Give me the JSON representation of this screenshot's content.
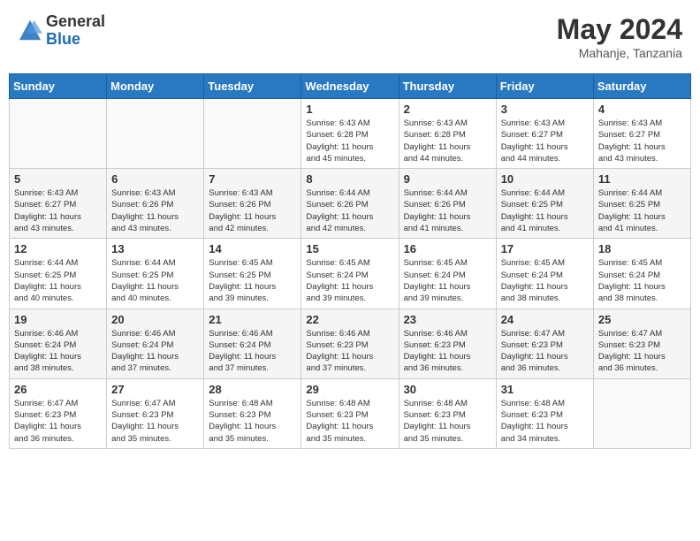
{
  "header": {
    "logo_general": "General",
    "logo_blue": "Blue",
    "month_title": "May 2024",
    "subtitle": "Mahanje, Tanzania"
  },
  "weekdays": [
    "Sunday",
    "Monday",
    "Tuesday",
    "Wednesday",
    "Thursday",
    "Friday",
    "Saturday"
  ],
  "weeks": [
    [
      {
        "day": "",
        "info": ""
      },
      {
        "day": "",
        "info": ""
      },
      {
        "day": "",
        "info": ""
      },
      {
        "day": "1",
        "info": "Sunrise: 6:43 AM\nSunset: 6:28 PM\nDaylight: 11 hours\nand 45 minutes."
      },
      {
        "day": "2",
        "info": "Sunrise: 6:43 AM\nSunset: 6:28 PM\nDaylight: 11 hours\nand 44 minutes."
      },
      {
        "day": "3",
        "info": "Sunrise: 6:43 AM\nSunset: 6:27 PM\nDaylight: 11 hours\nand 44 minutes."
      },
      {
        "day": "4",
        "info": "Sunrise: 6:43 AM\nSunset: 6:27 PM\nDaylight: 11 hours\nand 43 minutes."
      }
    ],
    [
      {
        "day": "5",
        "info": "Sunrise: 6:43 AM\nSunset: 6:27 PM\nDaylight: 11 hours\nand 43 minutes."
      },
      {
        "day": "6",
        "info": "Sunrise: 6:43 AM\nSunset: 6:26 PM\nDaylight: 11 hours\nand 43 minutes."
      },
      {
        "day": "7",
        "info": "Sunrise: 6:43 AM\nSunset: 6:26 PM\nDaylight: 11 hours\nand 42 minutes."
      },
      {
        "day": "8",
        "info": "Sunrise: 6:44 AM\nSunset: 6:26 PM\nDaylight: 11 hours\nand 42 minutes."
      },
      {
        "day": "9",
        "info": "Sunrise: 6:44 AM\nSunset: 6:26 PM\nDaylight: 11 hours\nand 41 minutes."
      },
      {
        "day": "10",
        "info": "Sunrise: 6:44 AM\nSunset: 6:25 PM\nDaylight: 11 hours\nand 41 minutes."
      },
      {
        "day": "11",
        "info": "Sunrise: 6:44 AM\nSunset: 6:25 PM\nDaylight: 11 hours\nand 41 minutes."
      }
    ],
    [
      {
        "day": "12",
        "info": "Sunrise: 6:44 AM\nSunset: 6:25 PM\nDaylight: 11 hours\nand 40 minutes."
      },
      {
        "day": "13",
        "info": "Sunrise: 6:44 AM\nSunset: 6:25 PM\nDaylight: 11 hours\nand 40 minutes."
      },
      {
        "day": "14",
        "info": "Sunrise: 6:45 AM\nSunset: 6:25 PM\nDaylight: 11 hours\nand 39 minutes."
      },
      {
        "day": "15",
        "info": "Sunrise: 6:45 AM\nSunset: 6:24 PM\nDaylight: 11 hours\nand 39 minutes."
      },
      {
        "day": "16",
        "info": "Sunrise: 6:45 AM\nSunset: 6:24 PM\nDaylight: 11 hours\nand 39 minutes."
      },
      {
        "day": "17",
        "info": "Sunrise: 6:45 AM\nSunset: 6:24 PM\nDaylight: 11 hours\nand 38 minutes."
      },
      {
        "day": "18",
        "info": "Sunrise: 6:45 AM\nSunset: 6:24 PM\nDaylight: 11 hours\nand 38 minutes."
      }
    ],
    [
      {
        "day": "19",
        "info": "Sunrise: 6:46 AM\nSunset: 6:24 PM\nDaylight: 11 hours\nand 38 minutes."
      },
      {
        "day": "20",
        "info": "Sunrise: 6:46 AM\nSunset: 6:24 PM\nDaylight: 11 hours\nand 37 minutes."
      },
      {
        "day": "21",
        "info": "Sunrise: 6:46 AM\nSunset: 6:24 PM\nDaylight: 11 hours\nand 37 minutes."
      },
      {
        "day": "22",
        "info": "Sunrise: 6:46 AM\nSunset: 6:23 PM\nDaylight: 11 hours\nand 37 minutes."
      },
      {
        "day": "23",
        "info": "Sunrise: 6:46 AM\nSunset: 6:23 PM\nDaylight: 11 hours\nand 36 minutes."
      },
      {
        "day": "24",
        "info": "Sunrise: 6:47 AM\nSunset: 6:23 PM\nDaylight: 11 hours\nand 36 minutes."
      },
      {
        "day": "25",
        "info": "Sunrise: 6:47 AM\nSunset: 6:23 PM\nDaylight: 11 hours\nand 36 minutes."
      }
    ],
    [
      {
        "day": "26",
        "info": "Sunrise: 6:47 AM\nSunset: 6:23 PM\nDaylight: 11 hours\nand 36 minutes."
      },
      {
        "day": "27",
        "info": "Sunrise: 6:47 AM\nSunset: 6:23 PM\nDaylight: 11 hours\nand 35 minutes."
      },
      {
        "day": "28",
        "info": "Sunrise: 6:48 AM\nSunset: 6:23 PM\nDaylight: 11 hours\nand 35 minutes."
      },
      {
        "day": "29",
        "info": "Sunrise: 6:48 AM\nSunset: 6:23 PM\nDaylight: 11 hours\nand 35 minutes."
      },
      {
        "day": "30",
        "info": "Sunrise: 6:48 AM\nSunset: 6:23 PM\nDaylight: 11 hours\nand 35 minutes."
      },
      {
        "day": "31",
        "info": "Sunrise: 6:48 AM\nSunset: 6:23 PM\nDaylight: 11 hours\nand 34 minutes."
      },
      {
        "day": "",
        "info": ""
      }
    ]
  ]
}
